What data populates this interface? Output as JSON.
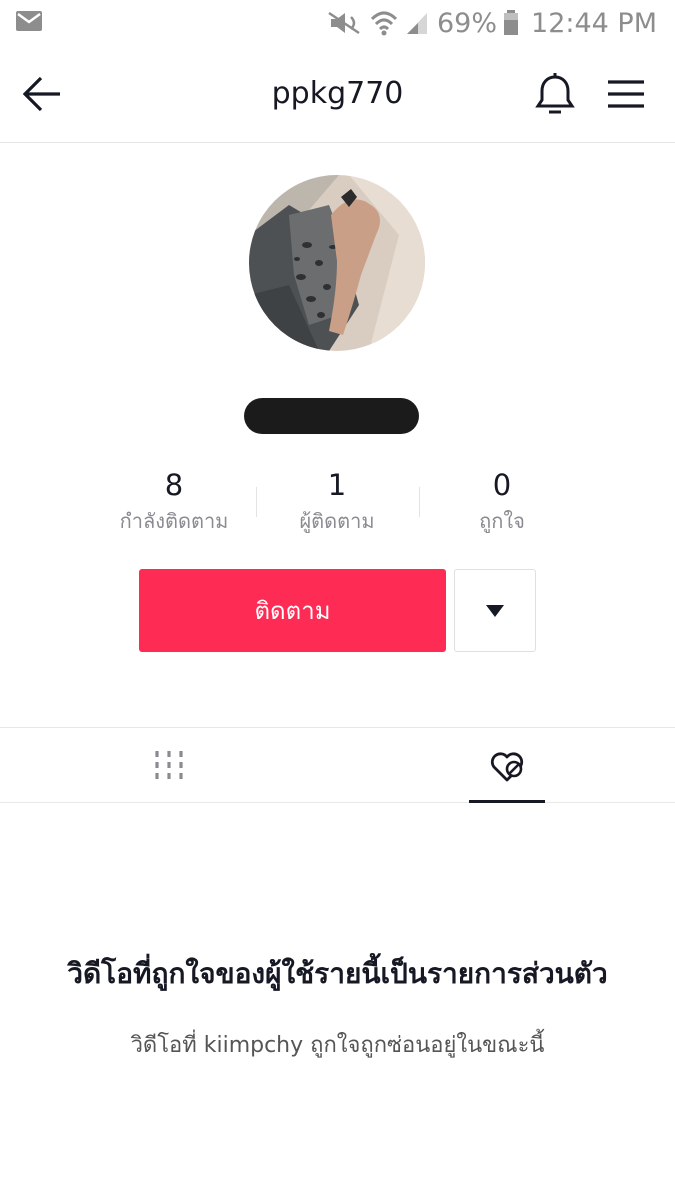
{
  "status_bar": {
    "battery_percent": "69%",
    "time": "12:44 PM",
    "icons": [
      "mail-icon",
      "mute-icon",
      "wifi-icon",
      "signal-icon",
      "battery-icon"
    ]
  },
  "header": {
    "title": "ppkg770",
    "icons": [
      "back-arrow-icon",
      "bell-icon",
      "menu-icon"
    ]
  },
  "profile": {
    "stats": [
      {
        "value": "8",
        "label": "กำลังติดตาม"
      },
      {
        "value": "1",
        "label": "ผู้ติดตาม"
      },
      {
        "value": "0",
        "label": "ถูกใจ"
      }
    ],
    "follow_label": "ติดตาม"
  },
  "tabs": {
    "items": [
      "videos-grid-icon",
      "liked-private-icon"
    ],
    "active": "liked-private-icon"
  },
  "private_notice": {
    "title": "วิดีโอที่ถูกใจของผู้ใช้รายนี้เป็นรายการส่วนตัว",
    "subtitle": "วิดีโอที่ kiimpchy ถูกใจถูกซ่อนอยู่ในขณะนี้"
  },
  "colors": {
    "accent": "#fe2c55",
    "text_primary": "#161823",
    "text_secondary": "#8a8b91"
  }
}
